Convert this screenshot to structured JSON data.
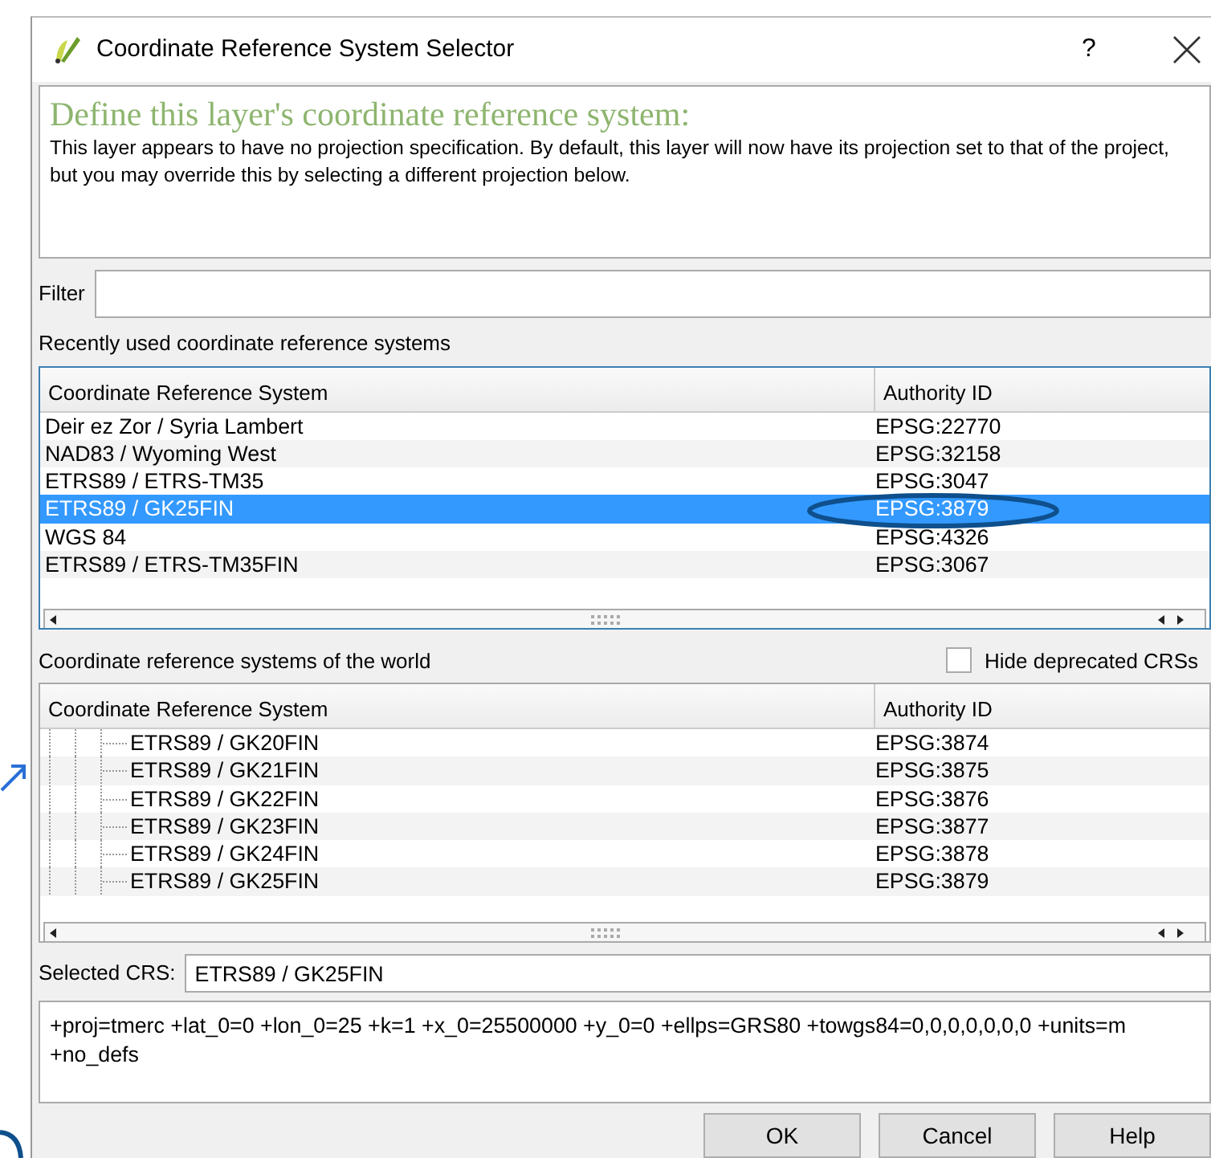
{
  "window": {
    "title": "Coordinate Reference System Selector",
    "help": "?"
  },
  "info": {
    "heading": "Define this layer's coordinate reference system:",
    "text": "This layer appears to have no projection specification. By default, this layer will now have its projection set to that of the project, but you may override this by selecting a different projection below."
  },
  "filter": {
    "label": "Filter"
  },
  "recent": {
    "label": "Recently used coordinate reference systems",
    "columns": [
      "Coordinate Reference System",
      "Authority ID"
    ],
    "rows": [
      {
        "name": "Deir ez Zor / Syria Lambert",
        "authority_id": "EPSG:22770",
        "selected": false
      },
      {
        "name": "NAD83 / Wyoming West",
        "authority_id": "EPSG:32158",
        "selected": false
      },
      {
        "name": "ETRS89 / ETRS-TM35",
        "authority_id": "EPSG:3047",
        "selected": false
      },
      {
        "name": "ETRS89 / GK25FIN",
        "authority_id": "EPSG:3879",
        "selected": true
      },
      {
        "name": "WGS 84",
        "authority_id": "EPSG:4326",
        "selected": false
      },
      {
        "name": "ETRS89 / ETRS-TM35FIN",
        "authority_id": "EPSG:3067",
        "selected": false
      }
    ]
  },
  "world": {
    "label": "Coordinate reference systems of the world",
    "hide_deprecated": {
      "label": "Hide deprecated CRSs",
      "checked": false
    },
    "columns": [
      "Coordinate Reference System",
      "Authority ID"
    ],
    "rows": [
      {
        "name": "ETRS89 / GK20FIN",
        "authority_id": "EPSG:3874"
      },
      {
        "name": "ETRS89 / GK21FIN",
        "authority_id": "EPSG:3875"
      },
      {
        "name": "ETRS89 / GK22FIN",
        "authority_id": "EPSG:3876"
      },
      {
        "name": "ETRS89 / GK23FIN",
        "authority_id": "EPSG:3877"
      },
      {
        "name": "ETRS89 / GK24FIN",
        "authority_id": "EPSG:3878"
      },
      {
        "name": "ETRS89 / GK25FIN",
        "authority_id": "EPSG:3879"
      }
    ]
  },
  "selected_crs": {
    "label": "Selected CRS:",
    "value": "ETRS89 / GK25FIN"
  },
  "proj_string": "+proj=tmerc +lat_0=0 +lon_0=25 +k=1 +x_0=25500000 +y_0=0 +ellps=GRS80 +towgs84=0,0,0,0,0,0,0 +units=m +no_defs",
  "buttons": [
    "OK",
    "Cancel",
    "Help"
  ]
}
